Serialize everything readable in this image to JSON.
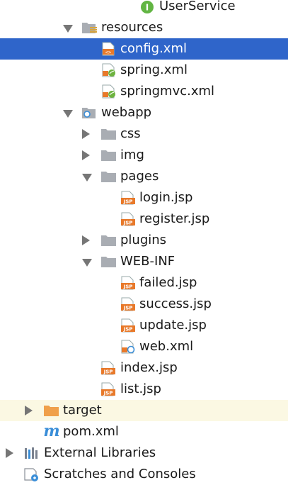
{
  "project_tree": {
    "items": [
      {
        "label": "UserService"
      },
      {
        "label": "resources"
      },
      {
        "label": "config.xml"
      },
      {
        "label": "spring.xml"
      },
      {
        "label": "springmvc.xml"
      },
      {
        "label": "webapp"
      },
      {
        "label": "css"
      },
      {
        "label": "img"
      },
      {
        "label": "pages"
      },
      {
        "label": "login.jsp"
      },
      {
        "label": "register.jsp"
      },
      {
        "label": "plugins"
      },
      {
        "label": "WEB-INF"
      },
      {
        "label": "failed.jsp"
      },
      {
        "label": "success.jsp"
      },
      {
        "label": "update.jsp"
      },
      {
        "label": "web.xml"
      },
      {
        "label": "index.jsp"
      },
      {
        "label": "list.jsp"
      },
      {
        "label": "target"
      },
      {
        "label": "pom.xml"
      },
      {
        "label": "External Libraries"
      },
      {
        "label": "Scratches and Consoles"
      }
    ]
  },
  "icons": {
    "jsp_badge": "JSP",
    "interface_badge": "I",
    "maven_badge": "m"
  },
  "colors": {
    "selection": "#2f65ca",
    "highlight_row": "#fbf8e3",
    "folder": "#a9adb3",
    "excluded_folder": "#f0a04b",
    "jsp_orange": "#e8792a",
    "spring_green": "#6db33f",
    "interface_green": "#62b543"
  }
}
